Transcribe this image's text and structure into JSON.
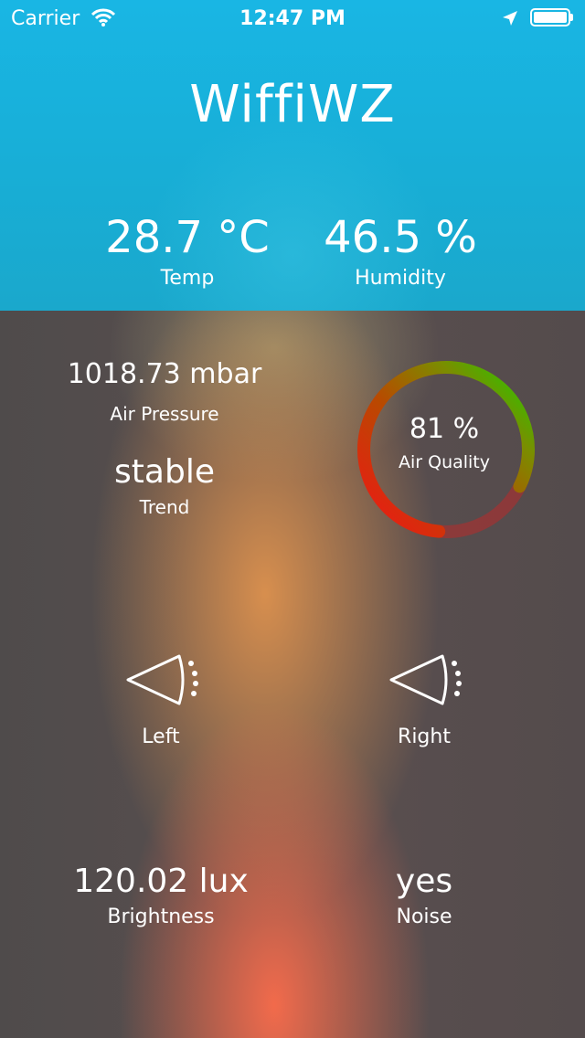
{
  "status_bar": {
    "carrier": "Carrier",
    "time": "12:47 PM",
    "wifi_icon": "wifi-icon",
    "location_icon": "location-arrow-icon",
    "battery_icon": "battery-full-icon"
  },
  "header": {
    "title": "WiffiWZ",
    "temperature": {
      "value": "28.7 °C",
      "label": "Temp"
    },
    "humidity": {
      "value": "46.5 %",
      "label": "Humidity"
    }
  },
  "air_pressure": {
    "value": "1018.73 mbar",
    "label": "Air Pressure"
  },
  "trend": {
    "value": "stable",
    "label": "Trend"
  },
  "air_quality": {
    "value": "81 %",
    "label": "Air Quality",
    "percent": 81
  },
  "motion": {
    "left": {
      "label": "Left",
      "icon": "motion-sensor-icon"
    },
    "right": {
      "label": "Right",
      "icon": "motion-sensor-icon"
    }
  },
  "brightness": {
    "value": "120.02 lux",
    "label": "Brightness"
  },
  "noise": {
    "value": "yes",
    "label": "Noise"
  },
  "colors": {
    "header_blue": "#19b6e4",
    "gauge_red": "#f01616",
    "gauge_green": "#22cc00"
  }
}
